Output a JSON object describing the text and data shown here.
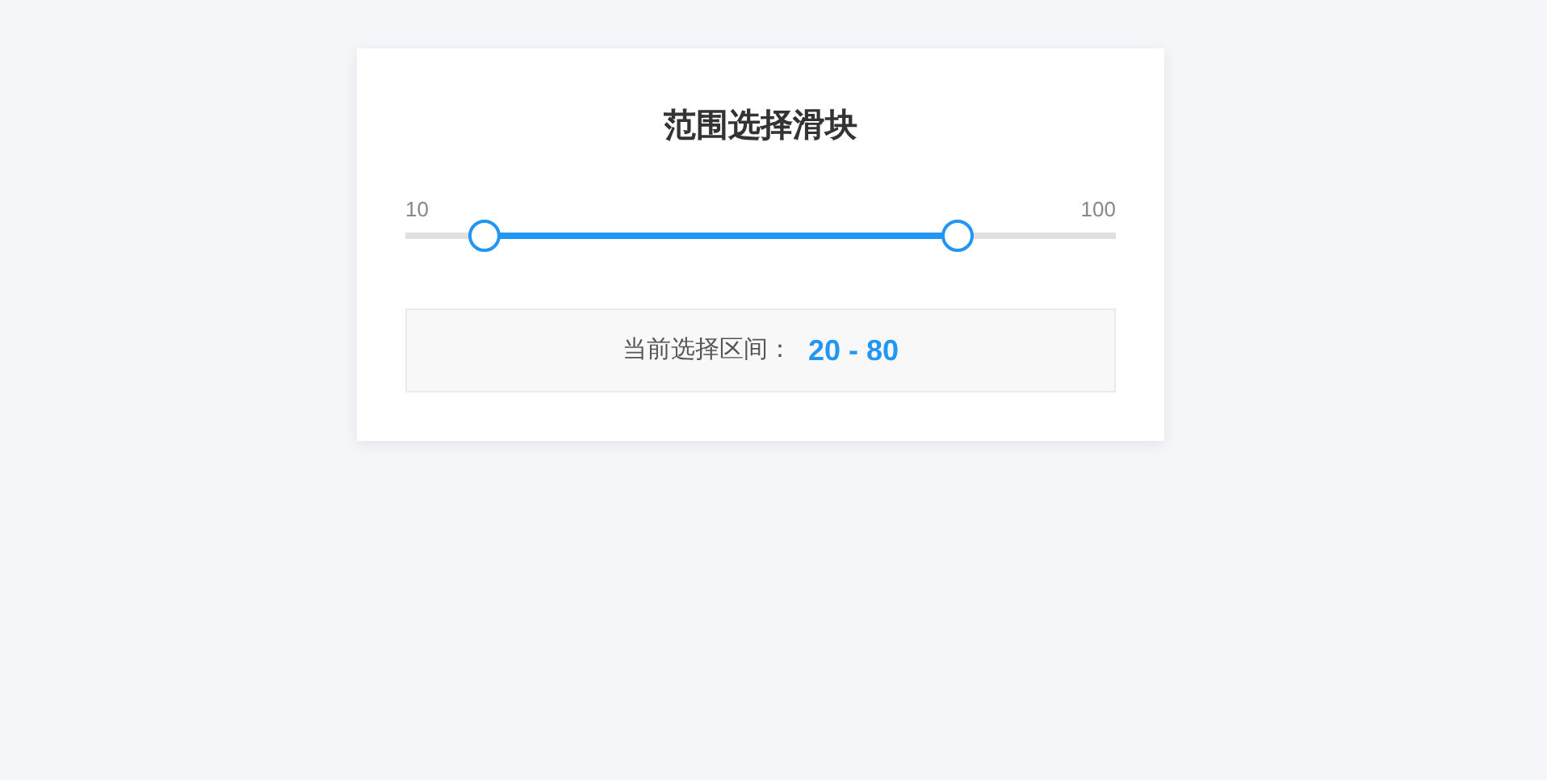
{
  "card": {
    "title": "范围选择滑块",
    "slider": {
      "min_label": "10",
      "max_label": "100",
      "thumbs": [
        {
          "level": 0.111
        },
        {
          "level": 0.778
        }
      ]
    },
    "result": {
      "label": "当前选择区间：",
      "value": "20 - 80"
    }
  }
}
